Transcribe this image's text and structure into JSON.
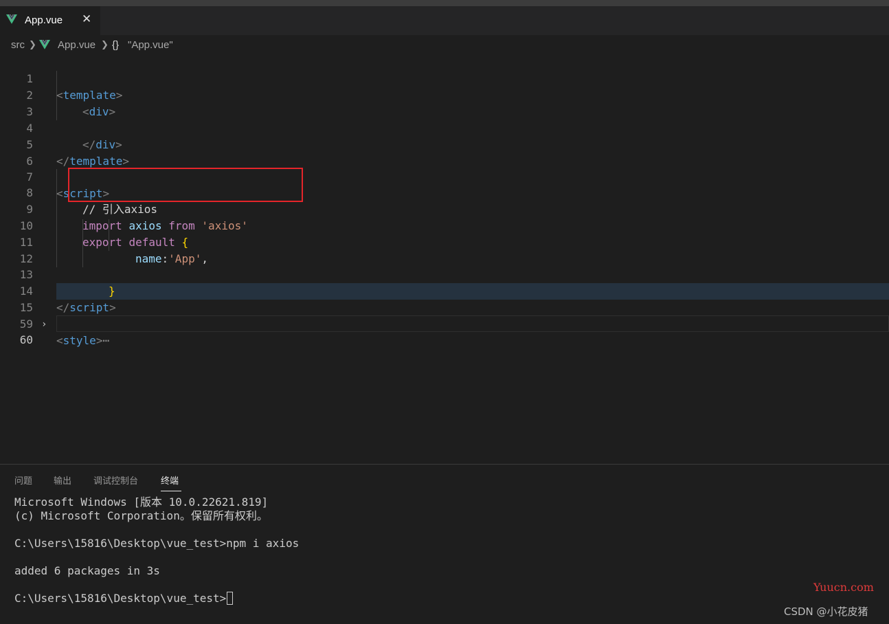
{
  "tab": {
    "file_name": "App.vue",
    "close_glyph": "✕",
    "icon": "vue-logo-icon"
  },
  "breadcrumb": {
    "folder": "src",
    "file": "App.vue",
    "symbol_icon": "{}",
    "symbol": "\"App.vue\""
  },
  "editor": {
    "line_numbers": [
      "1",
      "2",
      "3",
      "4",
      "5",
      "6",
      "7",
      "8",
      "9",
      "10",
      "11",
      "12",
      "13",
      "14",
      "15",
      "59",
      "60"
    ],
    "active_line": "60",
    "lines": {
      "l1": {
        "open": "<",
        "name": "template",
        "close": ">"
      },
      "l2": {
        "open": "<",
        "name": "div",
        "close": ">"
      },
      "l4": {
        "open": "</",
        "name": "div",
        "close": ">"
      },
      "l5": {
        "open": "</",
        "name": "template",
        "close": ">"
      },
      "l7": {
        "open": "<",
        "name": "script",
        "close": ">"
      },
      "l8": {
        "comment": "// 引入axios"
      },
      "l9": {
        "import": "import",
        "ident": "axios",
        "from": "from",
        "module": "'axios'"
      },
      "l10": {
        "export": "export",
        "default": "default",
        "brace": "{"
      },
      "l11": {
        "key": "name",
        "colon": ":",
        "value": "'App'",
        "comma": ","
      },
      "l13": {
        "brace": "}"
      },
      "l14": {
        "open": "</",
        "name": "script",
        "close": ">"
      },
      "l15": {
        "open": "<",
        "name": "style",
        "close": ">",
        "ellipsis": "⋯",
        "fold_glyph": "›"
      }
    }
  },
  "panel": {
    "tabs": [
      "问题",
      "输出",
      "调试控制台",
      "终端"
    ],
    "active_tab": "终端",
    "terminal": [
      "Microsoft Windows [版本 10.0.22621.819]",
      "(c) Microsoft Corporation。保留所有权利。",
      "",
      "C:\\Users\\15816\\Desktop\\vue_test>npm i axios",
      "",
      "added 6 packages in 3s",
      "",
      "C:\\Users\\15816\\Desktop\\vue_test>"
    ]
  },
  "watermarks": {
    "site": "Yuucn.com",
    "author": "CSDN @小花皮猪"
  },
  "colors": {
    "tag": "#569cd6",
    "keyword": "#c586c0",
    "string": "#ce9178",
    "variable": "#9cdcfe",
    "brace": "#ffd700",
    "highlight_box": "#e5252a"
  }
}
